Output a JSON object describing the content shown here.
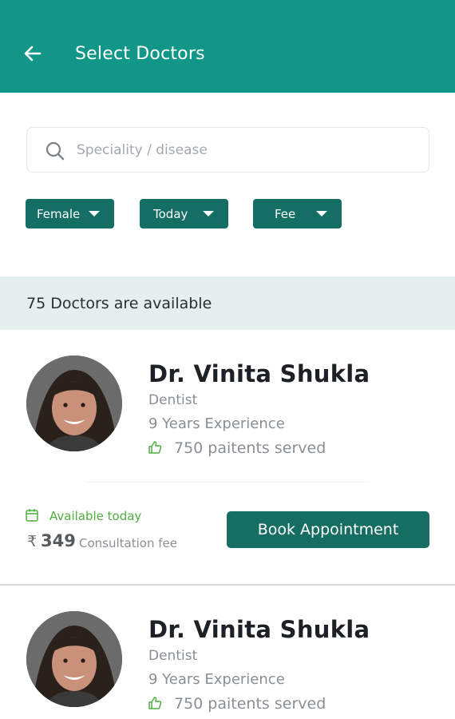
{
  "header": {
    "title": "Select Doctors",
    "back_icon": "arrow-left-icon",
    "background": "#129688"
  },
  "search": {
    "placeholder": "Speciality / disease",
    "value": "",
    "icon": "search-icon"
  },
  "filters": [
    {
      "label": "Female"
    },
    {
      "label": "Today"
    },
    {
      "label": "Fee"
    }
  ],
  "results": {
    "count_text": "75 Doctors are available"
  },
  "doctors": [
    {
      "name": "Dr. Vinita Shukla",
      "speciality": "Dentist",
      "experience": "9 Years Experience",
      "patients": "750 paitents served",
      "availability": "Available today",
      "currency": "₹",
      "fee": "349",
      "fee_label": "Consultation fee",
      "button": "Book Appointment"
    },
    {
      "name": "Dr. Vinita Shukla",
      "speciality": "Dentist",
      "experience": "9 Years Experience",
      "patients": "750 paitents served"
    }
  ],
  "colors": {
    "primary": "#129688",
    "button": "#166e63",
    "available": "#4fae3e",
    "banner": "#e5efee"
  }
}
